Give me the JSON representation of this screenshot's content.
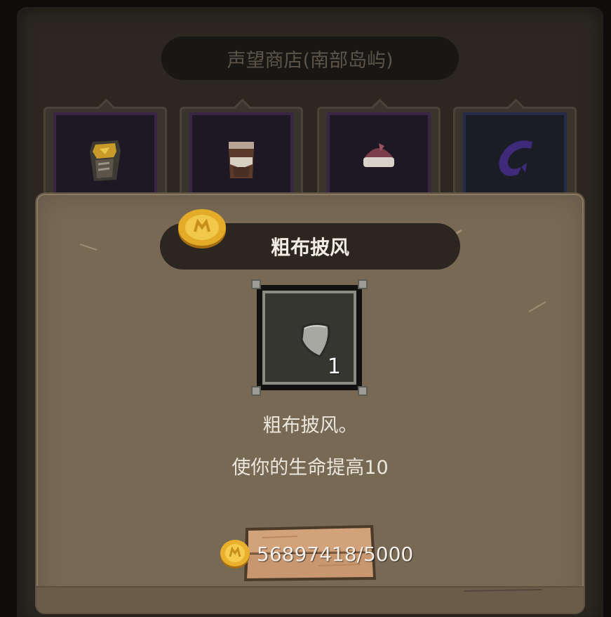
{
  "shop": {
    "title": "声望商店(南部岛屿)",
    "slots": [
      {
        "icon": "gold-armor-icon"
      },
      {
        "icon": "leather-armor-icon"
      },
      {
        "icon": "helmet-icon"
      },
      {
        "icon": "purple-scarf-icon"
      }
    ]
  },
  "dialog": {
    "item_name": "粗布披风",
    "item_icon": "cloak-shield-icon",
    "item_count": "1",
    "description": "粗布披风。",
    "effect": "使你的生命提高10",
    "price": "56897418/5000",
    "currency_icon": "gold-coin-icon"
  },
  "colors": {
    "panel_bg": "#2c2821",
    "dialog_bg": "#786955",
    "pill_bg": "#2b2620",
    "gold": "#e0a724"
  }
}
